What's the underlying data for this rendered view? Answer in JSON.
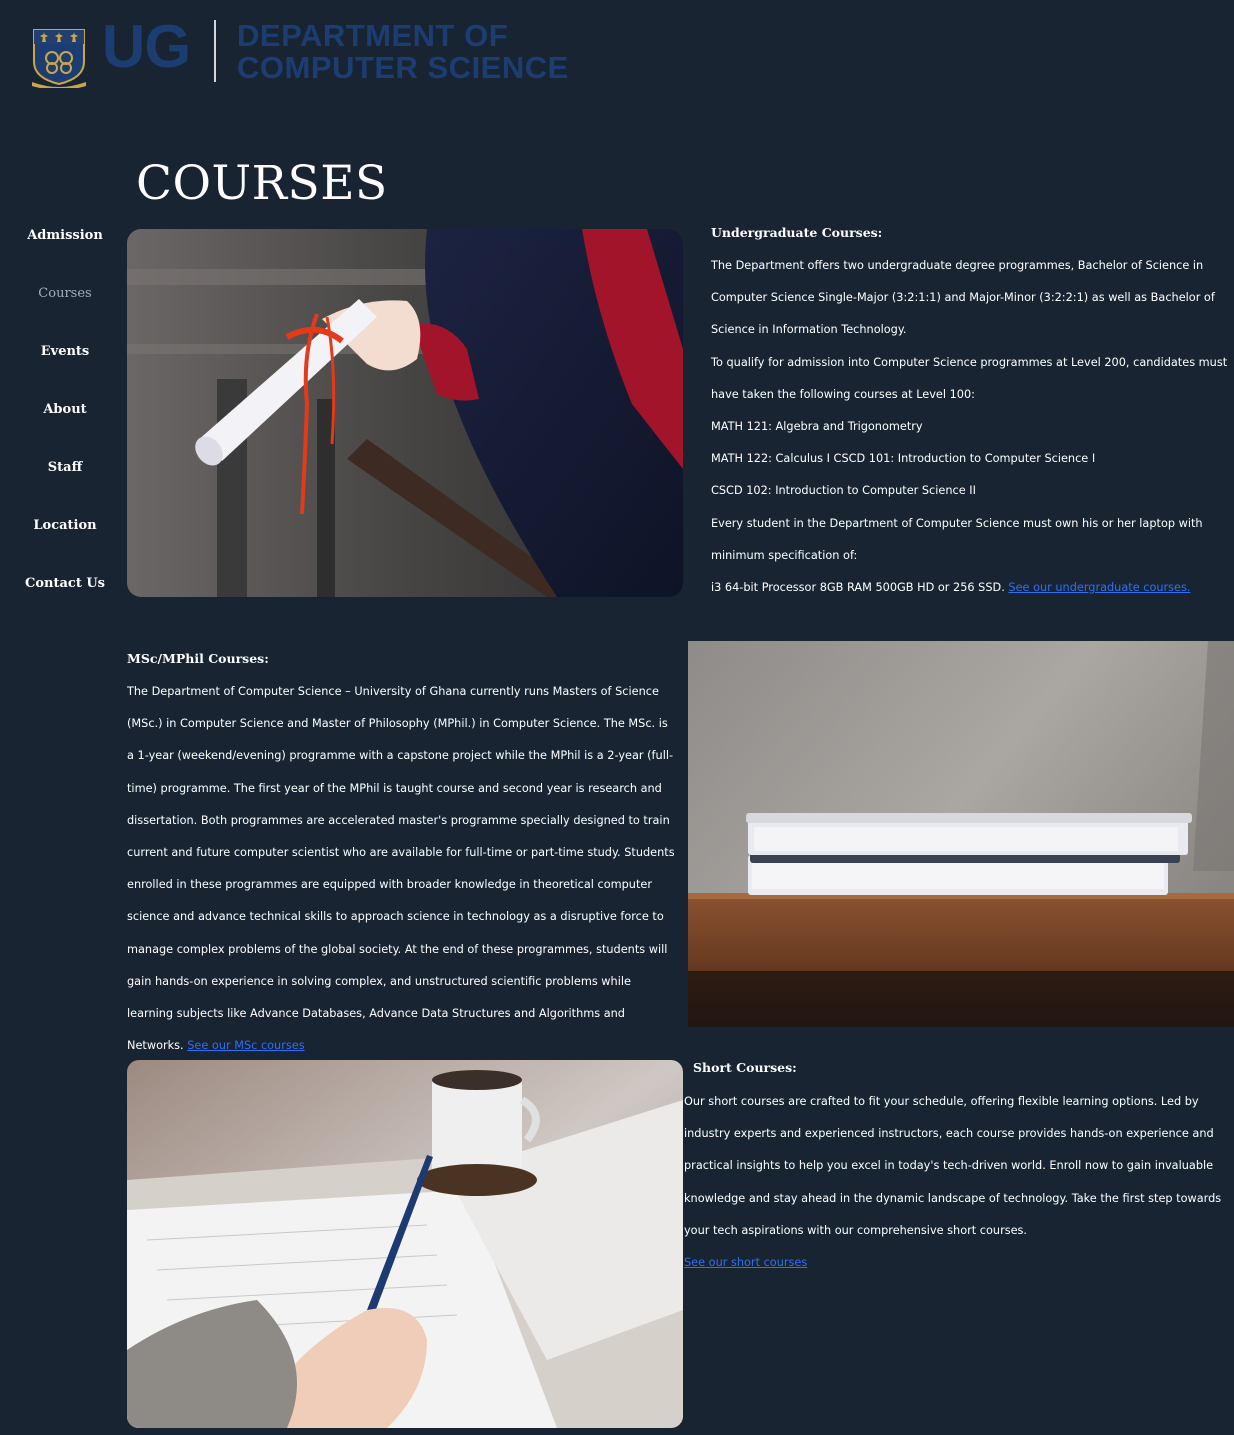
{
  "header": {
    "logo_letters": "UG",
    "department_line1": "DEPARTMENT OF",
    "department_line2": "COMPUTER SCIENCE"
  },
  "page_title": "COURSES",
  "sidebar": {
    "items": [
      {
        "label": "Admission",
        "active": false
      },
      {
        "label": "Courses",
        "active": true
      },
      {
        "label": "Events",
        "active": false
      },
      {
        "label": "About",
        "active": false
      },
      {
        "label": "Staff",
        "active": false
      },
      {
        "label": "Location",
        "active": false
      },
      {
        "label": "Contact Us",
        "active": false
      }
    ]
  },
  "undergraduate": {
    "heading": "Undergraduate Courses:",
    "p1": "The Department offers two undergraduate degree programmes, Bachelor of Science in Computer Science Single-Major (3:2:1:1) and Major-Minor (3:2:2:1) as well as Bachelor of Science in Information Technology.",
    "p2": "To qualify for admission into Computer Science programmes at Level 200, candidates must have taken the following courses at Level 100:",
    "p3": "MATH 121: Algebra and Trigonometry",
    "p4": "MATH 122: Calculus I CSCD 101: Introduction to Computer Science I",
    "p5": "CSCD 102: Introduction to Computer Science II",
    "p6": "Every student in the Department of Computer Science must own his or her laptop with minimum specification of:",
    "p7": "i3 64-bit Processor 8GB RAM 500GB HD or 256 SSD.",
    "link": "See our undergraduate courses."
  },
  "msc": {
    "heading": "MSc/MPhil Courses:",
    "body": "The Department of Computer Science – University of Ghana currently runs Masters of Science (MSc.) in Computer Science and Master of Philosophy (MPhil.) in Computer Science. The MSc. is a 1-year (weekend/evening) programme with a capstone project while the MPhil is a 2-year (full-time) programme. The first year of the MPhil is taught course and second year is research and dissertation. Both programmes are accelerated master's programme specially designed to train current and future computer scientist who are available for full-time or part-time study. Students enrolled in these programmes are equipped with broader knowledge in theoretical computer science and advance technical skills to approach science in technology as a disruptive force to manage complex problems of the global society. At the end of these programmes, students will gain hands-on experience in solving complex, and unstructured scientific problems while learning subjects like Advance Databases, Advance Data Structures and Algorithms and Networks.",
    "link": "See our MSc courses"
  },
  "short": {
    "heading": "Short Courses:",
    "body": "Our short courses are crafted to fit your schedule, offering flexible learning options. Led by industry experts and experienced instructors, each course provides hands-on experience and practical insights to help you excel in today's tech-driven world. Enroll now to gain invaluable knowledge and stay ahead in the dynamic landscape of technology. Take the first step towards your tech aspirations with our comprehensive short courses.",
    "link": "See our short courses"
  },
  "colors": {
    "background": "#192433",
    "logo_blue": "#1c3d72",
    "link": "#2f6ff2",
    "nav_active": "#a4acb7"
  },
  "icons": {
    "crest": "university-crest-icon"
  },
  "images": {
    "graduation": "graduation-diploma-photo",
    "books": "books-on-table-photo",
    "writing": "writing-at-desk-photo"
  }
}
